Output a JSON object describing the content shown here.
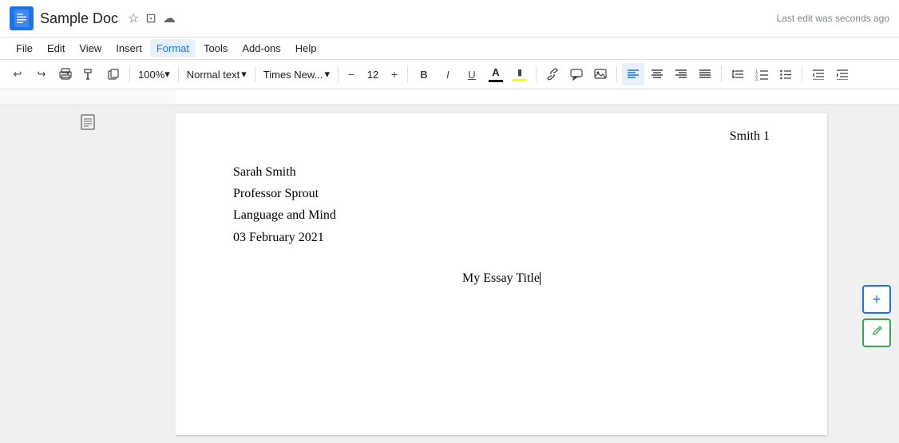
{
  "app": {
    "icon": "≡",
    "title": "Sample Doc",
    "last_edit": "Last edit was seconds ago"
  },
  "menu": {
    "items": [
      "File",
      "Edit",
      "View",
      "Insert",
      "Format",
      "Tools",
      "Add-ons",
      "Help"
    ]
  },
  "toolbar": {
    "undo_label": "↩",
    "redo_label": "↪",
    "print_label": "🖨",
    "paint_format_label": "🖌",
    "clone_label": "≡",
    "zoom": "100%",
    "zoom_arrow": "▾",
    "style": "Normal text",
    "style_arrow": "▾",
    "font": "Times New...",
    "font_arrow": "▾",
    "font_size": "12",
    "bold": "B",
    "italic": "I",
    "underline": "U",
    "align_left": "≡",
    "align_center": "≡",
    "align_right": "≡",
    "align_justify": "≡"
  },
  "document": {
    "header": "Smith 1",
    "lines": [
      "Sarah Smith",
      "Professor Sprout",
      "Language and Mind",
      "03 February 2021"
    ],
    "essay_title": "My Essay Title"
  },
  "right_actions": {
    "add_label": "+",
    "edit_label": "✎"
  }
}
